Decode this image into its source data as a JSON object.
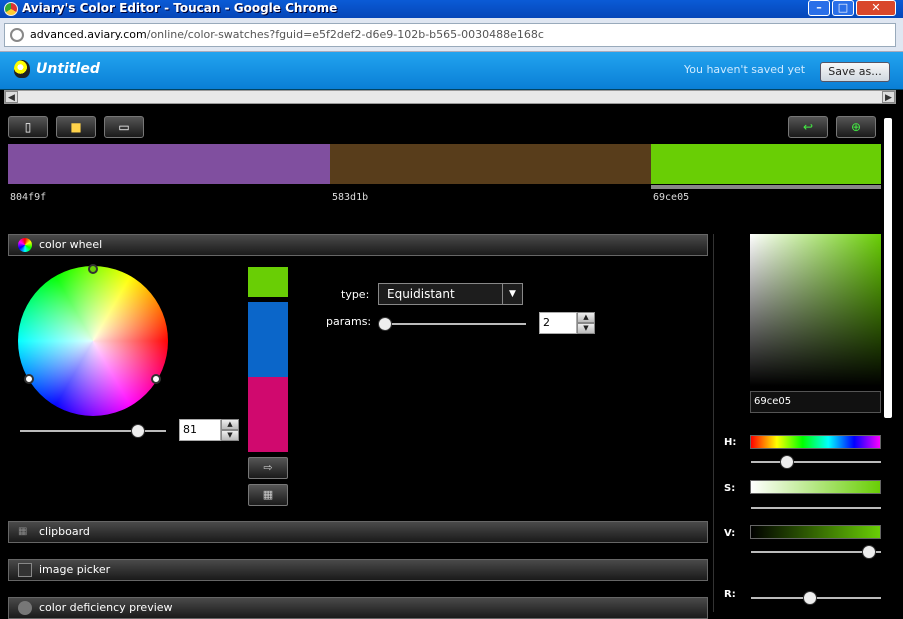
{
  "window": {
    "title": "Aviary's Color Editor - Toucan - Google Chrome"
  },
  "address": {
    "host": "advanced.aviary.com",
    "path": "/online/color-swatches?fguid=e5f2def2-d6e9-102b-b565-0030488e168c"
  },
  "app": {
    "doc_title": "Untitled",
    "save_status": "You haven't saved yet",
    "save_as_label": "Save as..."
  },
  "swatches": [
    {
      "hex": "804f9f",
      "color": "#804f9f"
    },
    {
      "hex": "583d1b",
      "color": "#583d1b"
    },
    {
      "hex": "69ce05",
      "color": "#69ce05"
    }
  ],
  "panels": {
    "color_wheel": "color wheel",
    "clipboard": "clipboard",
    "image_picker": "image picker",
    "color_deficiency": "color deficiency preview"
  },
  "wheel": {
    "brightness_value": "81",
    "brightness_level": 0.81,
    "harmony_colors": [
      "#69ce05",
      "#0b66c9",
      "#d0096e"
    ]
  },
  "harmony": {
    "type_label": "type:",
    "type_value": "Equidistant",
    "params_label": "params:",
    "params_value": "2"
  },
  "picker": {
    "hex_value": "69ce05",
    "h_label": "H:",
    "s_label": "S:",
    "v_label": "V:",
    "r_label": "R:"
  },
  "colors": {
    "accent": "#0a7fd6",
    "selected_swatch": "#69ce05"
  }
}
